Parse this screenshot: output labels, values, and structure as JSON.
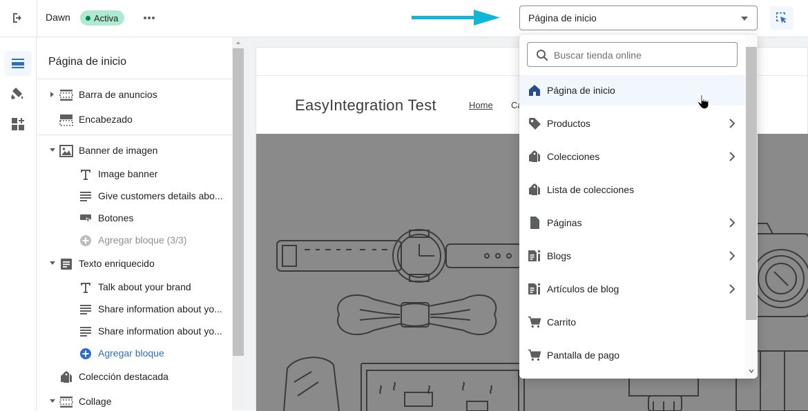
{
  "topbar": {
    "theme_name": "Dawn",
    "status_badge": "Activa",
    "page_selector_value": "Página de inicio"
  },
  "sidebar": {
    "title": "Página de inicio",
    "items": [
      {
        "label": "Barra de anuncios",
        "icon": "section-icon"
      },
      {
        "label": "Encabezado",
        "icon": "header-icon"
      },
      {
        "label": "Banner de imagen",
        "icon": "image-icon"
      },
      {
        "label": "Image banner",
        "icon": "text-icon"
      },
      {
        "label": "Give customers details abo...",
        "icon": "paragraph-icon"
      },
      {
        "label": "Botones",
        "icon": "button-icon"
      },
      {
        "label": "Agregar bloque (3/3)",
        "icon": "add-circle-icon"
      },
      {
        "label": "Texto enriquecido",
        "icon": "rich-text-icon"
      },
      {
        "label": "Talk about your brand",
        "icon": "text-icon"
      },
      {
        "label": "Share information about yo...",
        "icon": "paragraph-icon"
      },
      {
        "label": "Share information about yo...",
        "icon": "paragraph-icon"
      },
      {
        "label": "Agregar bloque",
        "icon": "add-circle-icon"
      },
      {
        "label": "Colección destacada",
        "icon": "collection-icon"
      },
      {
        "label": "Collage",
        "icon": "section-icon"
      }
    ]
  },
  "preview": {
    "store_name": "EasyIntegration Test",
    "nav_home": "Home",
    "nav_partial": "Ca"
  },
  "dropdown": {
    "search_placeholder": "Buscar tienda online",
    "items": [
      {
        "label": "Página de inicio",
        "icon": "home-icon",
        "selected": true,
        "has_submenu": false
      },
      {
        "label": "Productos",
        "icon": "tag-icon",
        "selected": false,
        "has_submenu": true
      },
      {
        "label": "Colecciones",
        "icon": "collection-icon",
        "selected": false,
        "has_submenu": true
      },
      {
        "label": "Lista de colecciones",
        "icon": "collection-icon",
        "selected": false,
        "has_submenu": false
      },
      {
        "label": "Páginas",
        "icon": "page-icon",
        "selected": false,
        "has_submenu": true
      },
      {
        "label": "Blogs",
        "icon": "blog-icon",
        "selected": false,
        "has_submenu": true
      },
      {
        "label": "Artículos de blog",
        "icon": "blog-icon",
        "selected": false,
        "has_submenu": true
      },
      {
        "label": "Carrito",
        "icon": "cart-icon",
        "selected": false,
        "has_submenu": false
      },
      {
        "label": "Pantalla de pago",
        "icon": "cart-icon",
        "selected": false,
        "has_submenu": false
      }
    ]
  },
  "colors": {
    "accent": "#2c6ecb",
    "badge_bg": "#aee9d1",
    "arrow": "#13b5d8",
    "banner_bg": "#8a8a8a"
  }
}
